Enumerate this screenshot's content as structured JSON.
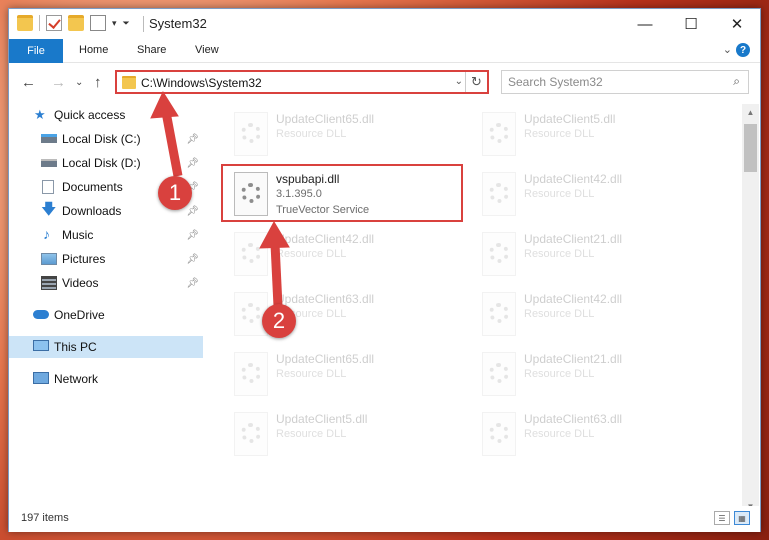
{
  "window": {
    "title": "System32",
    "controls": {
      "minimize": "—",
      "maximize": "☐",
      "close": "✕"
    }
  },
  "ribbon": {
    "tabs": [
      "File",
      "Home",
      "Share",
      "View"
    ],
    "help": "?"
  },
  "address": {
    "path": "C:\\Windows\\System32",
    "search_placeholder": "Search System32"
  },
  "nav": {
    "items": [
      {
        "label": "Quick access",
        "icon": "star-icon",
        "pinned": false
      },
      {
        "label": "Local Disk (C:)",
        "icon": "drive-icon",
        "pinned": true
      },
      {
        "label": "Local Disk (D:)",
        "icon": "drive-icon",
        "pinned": true
      },
      {
        "label": "Documents",
        "icon": "documents-icon",
        "pinned": true
      },
      {
        "label": "Downloads",
        "icon": "download-icon",
        "pinned": true
      },
      {
        "label": "Music",
        "icon": "music-icon",
        "pinned": true
      },
      {
        "label": "Pictures",
        "icon": "pictures-icon",
        "pinned": true
      },
      {
        "label": "Videos",
        "icon": "videos-icon",
        "pinned": true
      },
      {
        "label": "OneDrive",
        "icon": "cloud-icon",
        "pinned": false
      },
      {
        "label": "This PC",
        "icon": "computer-icon",
        "pinned": false,
        "selected": true
      },
      {
        "label": "Network",
        "icon": "network-icon",
        "pinned": false
      }
    ]
  },
  "files": [
    {
      "name": "UpdateClient65.dll",
      "desc": "Resource DLL"
    },
    {
      "name": "UpdateClient5.dll",
      "desc": "Resource DLL"
    },
    {
      "name": "vspubapi.dll",
      "desc": "3.1.395.0",
      "extra": "TrueVector Service"
    },
    {
      "name": "UpdateClient42.dll",
      "desc": "Resource DLL"
    },
    {
      "name": "UpdateClient42.dll",
      "desc": "Resource DLL"
    },
    {
      "name": "UpdateClient21.dll",
      "desc": "Resource DLL"
    },
    {
      "name": "UpdateClient63.dll",
      "desc": "Resource DLL"
    },
    {
      "name": "UpdateClient42.dll",
      "desc": "Resource DLL"
    },
    {
      "name": "UpdateClient65.dll",
      "desc": "Resource DLL"
    },
    {
      "name": "UpdateClient21.dll",
      "desc": "Resource DLL"
    },
    {
      "name": "UpdateClient5.dll",
      "desc": "Resource DLL"
    },
    {
      "name": "UpdateClient63.dll",
      "desc": "Resource DLL"
    }
  ],
  "status": {
    "item_count": "197 items"
  },
  "annotations": {
    "step1": "1",
    "step2": "2",
    "color": "#d9413e"
  }
}
